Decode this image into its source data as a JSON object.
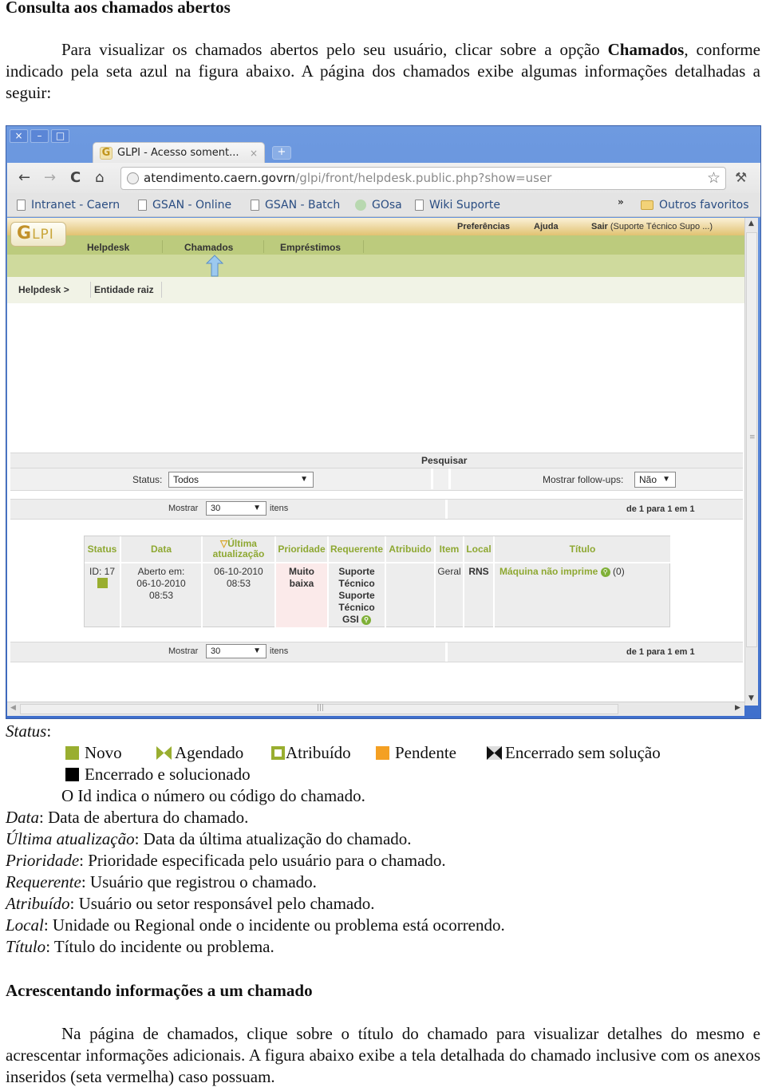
{
  "section1": {
    "heading": "Consulta aos chamados abertos",
    "intro_before_bold": "Para visualizar os chamados abertos pelo seu usuário, clicar sobre a opção ",
    "intro_bold": "Chamados",
    "intro_after_bold": ", conforme indicado pela seta azul na figura abaixo. A página dos chamados exibe algumas informações detalhadas a seguir:"
  },
  "browser": {
    "window_buttons": [
      "×",
      "–",
      "□"
    ],
    "tab_title": "GLPI - Acesso soment...",
    "tab_favicon": "G",
    "tab_close": "×",
    "new_tab": "+",
    "nav": {
      "back": "←",
      "forward": "→",
      "reload": "C",
      "home": "⌂"
    },
    "url_host": "atendimento.caern.govrn",
    "url_path": "/glpi/front/helpdesk.public.php?show=user",
    "star": "☆",
    "wrench": "🔧",
    "bookmarks": [
      {
        "label": "Intranet - Caern",
        "icon": "page-icon"
      },
      {
        "label": "GSAN - Online",
        "icon": "page-icon"
      },
      {
        "label": "GSAN - Batch",
        "icon": "page-icon"
      },
      {
        "label": "GOsa",
        "icon": "gosa-icon"
      },
      {
        "label": "Wiki Suporte",
        "icon": "page-icon"
      }
    ],
    "bookmarks_overflow": "»",
    "other_bookmarks": "Outros favoritos"
  },
  "glpi": {
    "logo": {
      "g": "G",
      "rest": "LPI"
    },
    "top_links": {
      "preferences": "Preferências",
      "help": "Ajuda",
      "logout_bold": "Sair",
      "logout_user": " (Suporte Técnico Supo ...)"
    },
    "menu": [
      "Helpdesk",
      "Chamados",
      "Empréstimos"
    ],
    "breadcrumb": [
      "Helpdesk >",
      "Entidade raiz"
    ],
    "search": {
      "title": "Pesquisar",
      "status_label": "Status:",
      "status_value": "Todos",
      "followups_label": "Mostrar follow-ups:",
      "followups_value": "Não"
    },
    "pager": {
      "show_label": "Mostrar",
      "show_value": "30",
      "items_label": "itens",
      "range_text": "de 1 para 1 em 1"
    },
    "table": {
      "headers": [
        "Status",
        "Data",
        "Última atualização",
        "Prioridade",
        "Requerente",
        "Atribuido",
        "Item",
        "Local",
        "Título"
      ],
      "sort_indicator": "▽",
      "header_last_update_line1": "Última",
      "header_last_update_line2": "atualização",
      "rows": [
        {
          "id": "ID: 17",
          "status_color": "#99ae30",
          "date_label": "Aberto em:",
          "date": "06-10-2010",
          "time": "08:53",
          "last_update_date": "06-10-2010",
          "last_update_time": "08:53",
          "priority_line1": "Muito",
          "priority_line2": "baixa",
          "requester_lines": [
            "Suporte",
            "Técnico",
            "Suporte",
            "Técnico",
            "GSI"
          ],
          "assigned": "",
          "item": "Geral",
          "location": "RNS",
          "title": "Máquina não imprime",
          "followup_count": "(0)"
        }
      ]
    }
  },
  "legend": {
    "label": "Status",
    "items": [
      {
        "label": "Novo",
        "icon": "solid-square",
        "color": "#99ae30"
      },
      {
        "label": "Agendado",
        "icon": "bowtie",
        "color": "#99ae30"
      },
      {
        "label": "Atribuído",
        "icon": "hollow-square",
        "color": "#99ae30"
      },
      {
        "label": "Pendente",
        "icon": "solid-square",
        "color": "#f4a023"
      },
      {
        "label": "Encerrado sem solução",
        "icon": "bowtie",
        "color": "#111111"
      },
      {
        "label": "Encerrado e solucionado",
        "icon": "solid-square",
        "color": "#000000"
      }
    ],
    "id_note": "O Id indica o número ou código do chamado."
  },
  "definitions": [
    {
      "term": "Data",
      "text": ": Data de abertura do chamado."
    },
    {
      "term": "Última atualização",
      "text": ": Data da última atualização do chamado."
    },
    {
      "term": "Prioridade",
      "text": ": Prioridade especificada pelo usuário para o chamado."
    },
    {
      "term": "Requerente",
      "text": ": Usuário que registrou o chamado."
    },
    {
      "term": "Atribuído",
      "text": ": Usuário ou setor responsável pelo chamado."
    },
    {
      "term": "Local",
      "text": ": Unidade ou Regional onde o incidente ou problema está ocorrendo."
    },
    {
      "term": "Título",
      "text": ": Título do incidente ou problema."
    }
  ],
  "section2": {
    "heading": "Acrescentando informações a um chamado",
    "paragraph": "Na página de chamados, clique sobre o título do chamado para visualizar detalhes do mesmo e acrescentar informações adicionais. A figura abaixo exibe a tela detalhada do chamado inclusive com os anexos inseridos (seta vermelha) caso possuam."
  }
}
